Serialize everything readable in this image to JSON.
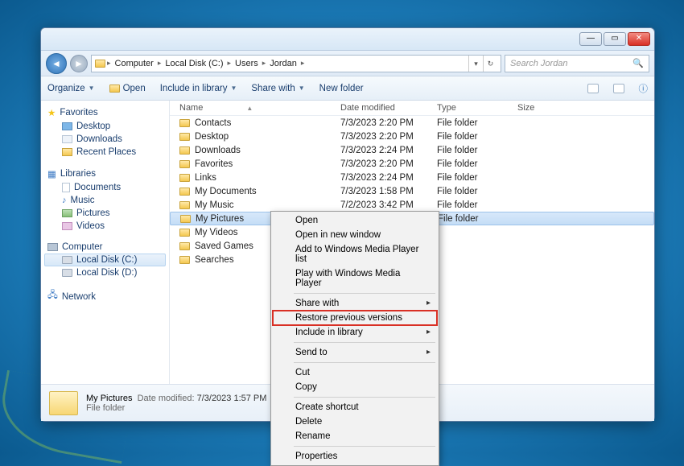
{
  "breadcrumb": [
    "Computer",
    "Local Disk (C:)",
    "Users",
    "Jordan"
  ],
  "search_placeholder": "Search Jordan",
  "toolbar": {
    "organize": "Organize",
    "open": "Open",
    "include": "Include in library",
    "share": "Share with",
    "newfolder": "New folder"
  },
  "nav": {
    "favorites": "Favorites",
    "desktop": "Desktop",
    "downloads": "Downloads",
    "recent": "Recent Places",
    "libraries": "Libraries",
    "documents": "Documents",
    "music": "Music",
    "pictures": "Pictures",
    "videos": "Videos",
    "computer": "Computer",
    "diskc": "Local Disk (C:)",
    "diskd": "Local Disk (D:)",
    "network": "Network"
  },
  "columns": {
    "name": "Name",
    "date": "Date modified",
    "type": "Type",
    "size": "Size"
  },
  "rows": [
    {
      "name": "Contacts",
      "date": "7/3/2023 2:20 PM",
      "type": "File folder"
    },
    {
      "name": "Desktop",
      "date": "7/3/2023 2:20 PM",
      "type": "File folder"
    },
    {
      "name": "Downloads",
      "date": "7/3/2023 2:24 PM",
      "type": "File folder"
    },
    {
      "name": "Favorites",
      "date": "7/3/2023 2:20 PM",
      "type": "File folder"
    },
    {
      "name": "Links",
      "date": "7/3/2023 2:24 PM",
      "type": "File folder"
    },
    {
      "name": "My Documents",
      "date": "7/3/2023 1:58 PM",
      "type": "File folder"
    },
    {
      "name": "My Music",
      "date": "7/2/2023 3:42 PM",
      "type": "File folder"
    },
    {
      "name": "My Pictures",
      "date": "7/3/2023 1:57 PM",
      "type": "File folder",
      "selected": true
    },
    {
      "name": "My Videos",
      "date": "",
      "type": ""
    },
    {
      "name": "Saved Games",
      "date": "",
      "type": ""
    },
    {
      "name": "Searches",
      "date": "",
      "type": ""
    }
  ],
  "details": {
    "title": "My Pictures",
    "meta_label": "Date modified:",
    "meta_value": "7/3/2023 1:57 PM",
    "type": "File folder"
  },
  "context_menu": {
    "open": "Open",
    "open_new": "Open in new window",
    "wmp_add": "Add to Windows Media Player list",
    "wmp_play": "Play with Windows Media Player",
    "share": "Share with",
    "restore": "Restore previous versions",
    "include": "Include in library",
    "sendto": "Send to",
    "cut": "Cut",
    "copy": "Copy",
    "shortcut": "Create shortcut",
    "delete": "Delete",
    "rename": "Rename",
    "properties": "Properties"
  }
}
